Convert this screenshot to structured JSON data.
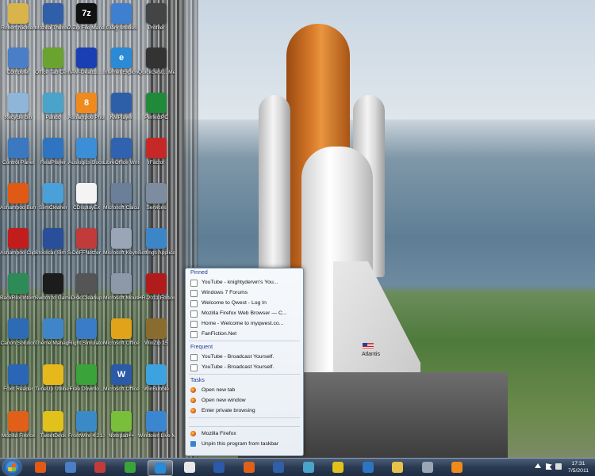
{
  "desktop_icons": [
    {
      "label": "Robert Nielsen",
      "icon": "user-folder-icon",
      "color": "#d9b44a"
    },
    {
      "label": "Mozilla Thunderbird",
      "icon": "thunderbird-icon",
      "color": "#2f5fa8"
    },
    {
      "label": "7-Zip File Manager",
      "icon": "7zip-icon",
      "color": "#111111",
      "glyph": "7z"
    },
    {
      "label": "Glary Utilities",
      "icon": "glary-utilities-icon",
      "color": "#3f7fd0"
    },
    {
      "label": "Profiler",
      "icon": "profiler-icon",
      "color": "#444444"
    },
    {
      "label": "Computer",
      "icon": "computer-icon",
      "color": "#4a7ec6"
    },
    {
      "label": "Office Tab Center",
      "icon": "office-tab-icon",
      "color": "#6aa32e"
    },
    {
      "label": "AM-DeadLi...",
      "icon": "am-deadlink-icon",
      "color": "#1a3fb5"
    },
    {
      "label": "Internet Explorer",
      "icon": "internet-explorer-icon",
      "color": "#2a8ad6",
      "glyph": "e"
    },
    {
      "label": "QuickGest... Media Pla...",
      "icon": "media-player-icon",
      "color": "#333333"
    },
    {
      "label": "Recycle Bin",
      "icon": "recycle-bin-icon",
      "color": "#8fb5d8"
    },
    {
      "label": "Pando",
      "icon": "pando-icon",
      "color": "#4aa3c8"
    },
    {
      "label": "Ashampoo Photo Co...",
      "icon": "ashampoo-photo-icon",
      "color": "#f08a1c",
      "glyph": "8"
    },
    {
      "label": "KMPlayer",
      "icon": "kmplayer-icon",
      "color": "#2d5fa8"
    },
    {
      "label": "PerfectPC",
      "icon": "perfectpc-icon",
      "color": "#1f8a3a"
    },
    {
      "label": "Control Panel",
      "icon": "control-panel-icon",
      "color": "#3a78c2"
    },
    {
      "label": "RealPlayer",
      "icon": "realplayer-icon",
      "color": "#2f74c0"
    },
    {
      "label": "Auslogics BoostSpeed",
      "icon": "auslogics-icon",
      "color": "#3c8ed6"
    },
    {
      "label": "LibreOffice Writer",
      "icon": "libreoffice-writer-icon",
      "color": "#2f63b0"
    },
    {
      "label": "rFactor",
      "icon": "rfactor-icon",
      "color": "#c62828"
    },
    {
      "label": "Ashampoo Burning",
      "icon": "ashampoo-burning-icon",
      "color": "#e05a16"
    },
    {
      "label": "SlimCleaner",
      "icon": "slimcleaner-icon",
      "color": "#4aa0d8"
    },
    {
      "label": "CDisplayEx",
      "icon": "cdisplayex-icon",
      "color": "#f4f4f4"
    },
    {
      "label": "Microsoft Calculat...",
      "icon": "calculator-icon",
      "color": "#6c7f99"
    },
    {
      "label": "Services",
      "icon": "services-icon",
      "color": "#7d8c9e"
    },
    {
      "label": "Ashampoo ClipFind...",
      "icon": "ashampoo-clipfinder-icon",
      "color": "#c21d1d"
    },
    {
      "label": "Stockcar Sim Series",
      "icon": "stockcar-icon",
      "color": "#2a4f9a"
    },
    {
      "label": "DeFFNetzer",
      "icon": "deffnetzer-icon",
      "color": "#c23b3b"
    },
    {
      "label": "Microsoft Keyboard",
      "icon": "keyboard-icon",
      "color": "#9aa6b5"
    },
    {
      "label": "Settings Application",
      "icon": "settings-icon",
      "color": "#3c86c8"
    },
    {
      "label": "BackRex Intern...",
      "icon": "backrex-icon",
      "color": "#2e8b57"
    },
    {
      "label": "Switch to Gamin...",
      "icon": "gaming-icon",
      "color": "#1c1c1c"
    },
    {
      "label": "Disk Cleanup",
      "icon": "disk-cleanup-icon",
      "color": "#555555"
    },
    {
      "label": "Microsoft Mouse",
      "icon": "mouse-icon",
      "color": "#8d98a8"
    },
    {
      "label": "HR-2011 Edition",
      "icon": "hr2011-icon",
      "color": "#b01c1c"
    },
    {
      "label": "Canon Solution",
      "icon": "canon-icon",
      "color": "#2d6bb5"
    },
    {
      "label": "Theme Manager",
      "icon": "theme-manager-icon",
      "color": "#3f86c9"
    },
    {
      "label": "Flight Simulator X",
      "icon": "flight-simulator-icon",
      "color": "#3a7cc8"
    },
    {
      "label": "Microsoft Office Outl...",
      "icon": "outlook-icon",
      "color": "#e0a31a"
    },
    {
      "label": "WinZip 15",
      "icon": "winzip-icon",
      "color": "#8a6d2e"
    },
    {
      "label": "Foxit Reader",
      "icon": "foxit-reader-icon",
      "color": "#2a66b5"
    },
    {
      "label": "TuneUp Utilities",
      "icon": "tuneup-icon",
      "color": "#e6b81c"
    },
    {
      "label": "Free Downlo...",
      "icon": "free-download-icon",
      "color": "#3aa33a"
    },
    {
      "label": "Microsoft Office Wor...",
      "icon": "word-icon",
      "color": "#2b5aa8",
      "glyph": "W"
    },
    {
      "label": "WinBubble",
      "icon": "winbubble-icon",
      "color": "#3da3e0"
    },
    {
      "label": "Mozilla Firefox",
      "icon": "firefox-icon",
      "color": "#e0601a"
    },
    {
      "label": "TweetDeck",
      "icon": "tweetdeck-icon",
      "color": "#e0c21a"
    },
    {
      "label": "FrostWire 4.21.8",
      "icon": "frostwire-icon",
      "color": "#3a8ac8"
    },
    {
      "label": "Notepad++",
      "icon": "notepadpp-icon",
      "color": "#7abf3c"
    },
    {
      "label": "Windows Live Mail",
      "icon": "live-mail-icon",
      "color": "#3a86d0"
    }
  ],
  "jumplist": {
    "pinned_header": "Pinned",
    "pinned": [
      "YouTube - knightyderwn's You...",
      "Windows 7 Forums",
      "Welcome to Qwest - Log In",
      "Mozilla Firefox Web Browser — C...",
      "Home - Welcome to myqwest.co...",
      "FanFiction.Net"
    ],
    "frequent_header": "Frequent",
    "frequent": [
      "YouTube - Broadcast Yourself.",
      "YouTube - Broadcast Yourself."
    ],
    "tasks_header": "Tasks",
    "tasks": [
      "Open new tab",
      "Open new window",
      "Enter private browsing"
    ],
    "app_label": "Mozilla Firefox",
    "unpin_label": "Unpin this program from taskbar"
  },
  "wallpaper": {
    "orbiter_label": "Atlantis"
  },
  "taskbar": {
    "buttons": [
      {
        "icon": "ashampoo-burning-icon",
        "color": "#e05a16"
      },
      {
        "icon": "computer-icon",
        "color": "#4a7ec6"
      },
      {
        "icon": "books-icon",
        "color": "#c23b3b"
      },
      {
        "icon": "network-icon",
        "color": "#3aa33a"
      },
      {
        "icon": "internet-explorer-icon",
        "color": "#2a8ad6",
        "active": true
      },
      {
        "icon": "document-icon",
        "color": "#e8e8e8"
      },
      {
        "icon": "word-icon",
        "color": "#2b5aa8"
      },
      {
        "icon": "firefox-icon",
        "color": "#e0601a"
      },
      {
        "icon": "thunderbird-icon",
        "color": "#2f5fa8"
      },
      {
        "icon": "pando-icon",
        "color": "#4aa3c8"
      },
      {
        "icon": "tweetdeck-icon",
        "color": "#e0c21a"
      },
      {
        "icon": "realplayer-icon",
        "color": "#2f74c0"
      },
      {
        "icon": "folder-icon",
        "color": "#e8c14a"
      },
      {
        "icon": "camera-icon",
        "color": "#9aa6b5"
      },
      {
        "icon": "media-player-icon",
        "color": "#f08a1c"
      }
    ],
    "time": "17:31",
    "date": "7/5/2011"
  }
}
